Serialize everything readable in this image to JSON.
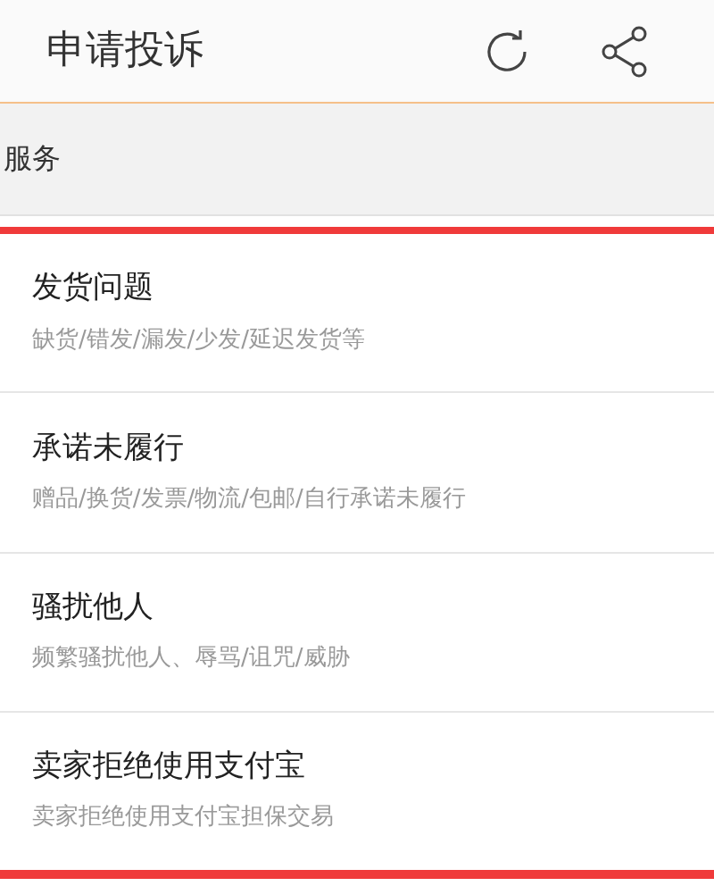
{
  "header": {
    "title": "申请投诉"
  },
  "section": {
    "title": "服务"
  },
  "items": [
    {
      "title": "发货问题",
      "subtitle": "缺货/错发/漏发/少发/延迟发货等"
    },
    {
      "title": "承诺未履行",
      "subtitle": "赠品/换货/发票/物流/包邮/自行承诺未履行"
    },
    {
      "title": "骚扰他人",
      "subtitle": "频繁骚扰他人、辱骂/诅咒/威胁"
    },
    {
      "title": "卖家拒绝使用支付宝",
      "subtitle": "卖家拒绝使用支付宝担保交易"
    }
  ]
}
